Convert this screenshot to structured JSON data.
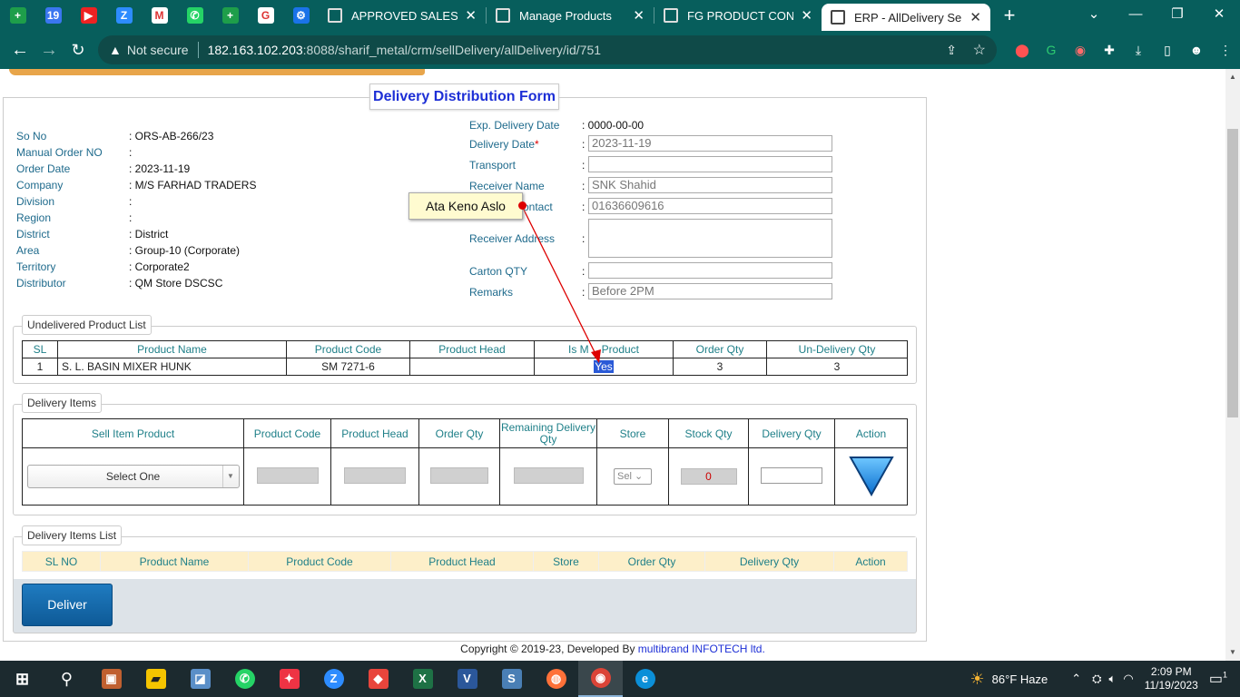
{
  "browser": {
    "pinned_tabs": [
      {
        "icon": "sheets-icon",
        "color": "#1e9e4a",
        "glyph": "+"
      },
      {
        "icon": "calendar-icon",
        "color": "#3a76f0",
        "glyph": "19"
      },
      {
        "icon": "youtube-icon",
        "color": "#e22",
        "glyph": "▶"
      },
      {
        "icon": "zoom-icon",
        "color": "#2d8cff",
        "glyph": "Z"
      },
      {
        "icon": "gmail-icon",
        "color": "#fff",
        "glyph": "M"
      },
      {
        "icon": "whatsapp-icon",
        "color": "#25d366",
        "glyph": "✆"
      },
      {
        "icon": "sheets-icon",
        "color": "#1e9e4a",
        "glyph": "+"
      },
      {
        "icon": "google-photos-icon",
        "color": "#fff",
        "glyph": "G"
      },
      {
        "icon": "settings-icon",
        "color": "#1a73e8",
        "glyph": "⚙"
      }
    ],
    "tabs": [
      {
        "title": "APPROVED SALES ORDER",
        "close": "✕"
      },
      {
        "title": "Manage Products",
        "close": "✕"
      },
      {
        "title": "FG PRODUCT CONFIG",
        "close": "✕"
      },
      {
        "title": "ERP - AllDelivery SellDelivery",
        "close": "✕"
      }
    ],
    "new_tab": "+",
    "address": {
      "security": "Not secure",
      "host": "182.163.102.203",
      "path": ":8088/sharif_metal/crm/sellDelivery/allDelivery/id/751"
    }
  },
  "form": {
    "title": "Delivery Distribution Form",
    "left_fields": [
      {
        "label": "So No",
        "value": ": ORS-AB-266/23"
      },
      {
        "label": "Manual Order NO",
        "value": ":"
      },
      {
        "label": "Order Date",
        "value": ": 2023-11-19"
      },
      {
        "label": "Company",
        "value": ": M/S FARHAD TRADERS"
      },
      {
        "label": "Division",
        "value": ":"
      },
      {
        "label": "Region",
        "value": ":"
      },
      {
        "label": "District",
        "value": ": District"
      },
      {
        "label": "Area",
        "value": ": Group-10 (Corporate)"
      },
      {
        "label": "Territory",
        "value": ": Corporate2"
      },
      {
        "label": "Distributor",
        "value": ": QM Store DSCSC"
      }
    ],
    "exp_delivery": {
      "label": "Exp. Delivery Date",
      "value": ": 0000-00-00"
    },
    "delivery_date": {
      "label": "Delivery Date",
      "req": "*",
      "value": "2023-11-19"
    },
    "transport": {
      "label": "Transport",
      "value": ""
    },
    "receiver_name": {
      "label": "Receiver Name",
      "value": "SNK Shahid"
    },
    "contact": {
      "label": "ontact",
      "value": "01636609616"
    },
    "receiver_address": {
      "label": "Receiver Address",
      "value": ""
    },
    "carton_qty": {
      "label": "Carton QTY",
      "value": ""
    },
    "remarks": {
      "label": "Remarks",
      "value": "Before 2PM"
    },
    "colon": ":"
  },
  "undelivered": {
    "legend": "Undelivered Product List",
    "headers": [
      "SL",
      "Product Name",
      "Product Code",
      "Product Head",
      "Is M",
      "Product",
      "Order Qty",
      "Un-Delivery Qty"
    ],
    "row": {
      "sl": "1",
      "name": "S. L. BASIN MIXER HUNK",
      "code": "SM 7271-6",
      "head": "",
      "main": "Yes",
      "order": "3",
      "undelivery": "3"
    }
  },
  "delivery_items": {
    "legend": "Delivery Items",
    "headers": [
      "Sell Item Product",
      "Product Code",
      "Product Head",
      "Order Qty",
      "Remaining Delivery Qty",
      "Store",
      "Stock Qty",
      "Delivery Qty",
      "Action"
    ],
    "select_placeholder": "Select One",
    "store_select": "Sel",
    "stock_qty": "0"
  },
  "items_list": {
    "legend": "Delivery Items List",
    "headers": [
      "SL NO",
      "Product Name",
      "Product Code",
      "Product Head",
      "Store",
      "Order Qty",
      "Delivery Qty",
      "Action"
    ]
  },
  "deliver_button": "Deliver",
  "footer": {
    "text": "Copyright © 2019-23, Developed By ",
    "brand": "multibrand INFOTECH ltd."
  },
  "annotation": {
    "text": "Ata Keno Aslo",
    "color": "#dd0000"
  },
  "taskbar": {
    "weather": "86°F  Haze",
    "time": "2:09 PM",
    "date": "11/19/2023",
    "notif": "1"
  }
}
